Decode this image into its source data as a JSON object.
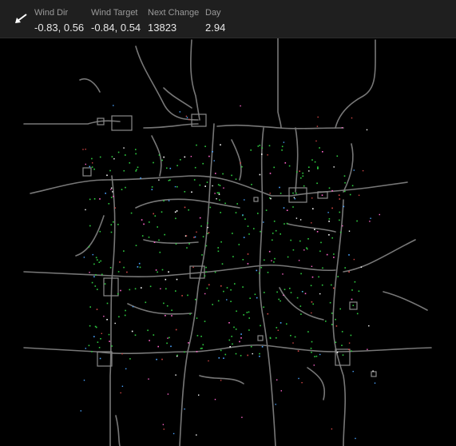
{
  "header": {
    "wind_arrow_icon": "arrow-down-left-icon",
    "stats": [
      {
        "label": "Wind Dir",
        "value": "-0.83, 0.56"
      },
      {
        "label": "Wind Target",
        "value": "-0.84, 0.54"
      },
      {
        "label": "Next Change",
        "value": "13823"
      },
      {
        "label": "Day",
        "value": "2.94"
      }
    ]
  },
  "map": {
    "background": "#000000",
    "road_color": "#7a7a7a",
    "building_color": "#8a8a8a",
    "vegetation_color": "#2ecc40",
    "marker_colors": [
      "#ffffff",
      "#ff66cc",
      "#d24646",
      "#4aa3ff"
    ]
  }
}
